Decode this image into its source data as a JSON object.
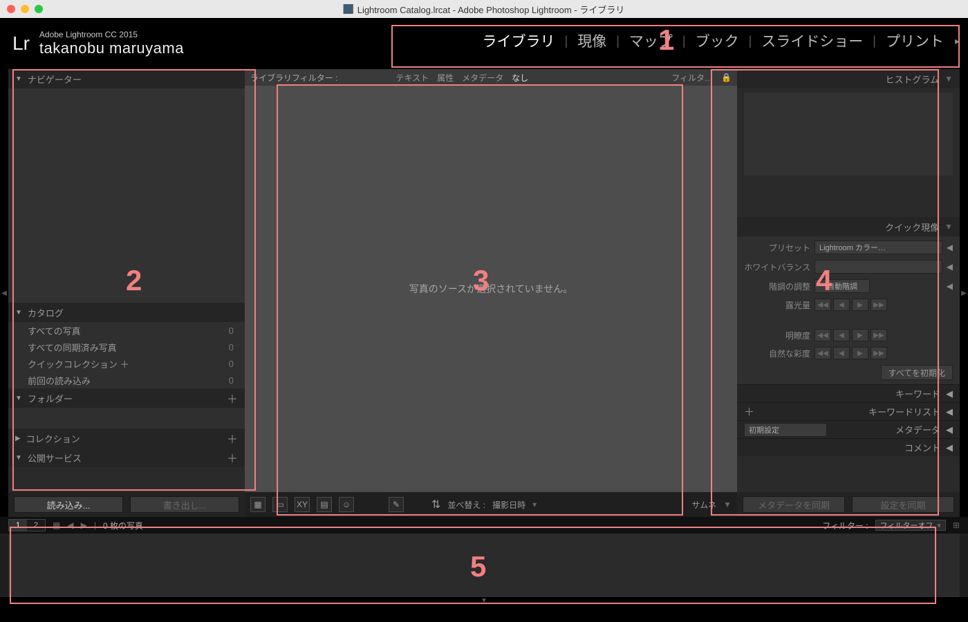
{
  "window": {
    "title": "Lightroom Catalog.lrcat - Adobe Photoshop Lightroom - ライブラリ"
  },
  "identity": {
    "product": "Adobe Lightroom CC 2015",
    "user": "takanobu maruyama",
    "logo": "Lr"
  },
  "modules": {
    "items": [
      "ライブラリ",
      "現像",
      "マップ",
      "ブック",
      "スライドショー",
      "プリント"
    ],
    "active_index": 0
  },
  "annotations": {
    "n1": "1",
    "n2": "2",
    "n3": "3",
    "n4": "4",
    "n5": "5"
  },
  "left": {
    "navigator": {
      "title": "ナビゲーター"
    },
    "catalog": {
      "title": "カタログ",
      "items": [
        {
          "label": "すべての写真",
          "count": "0"
        },
        {
          "label": "すべての同期済み写真",
          "count": "0"
        },
        {
          "label": "クイックコレクション ＋",
          "count": "0"
        },
        {
          "label": "前回の読み込み",
          "count": "0"
        }
      ]
    },
    "folders": {
      "title": "フォルダー"
    },
    "collections": {
      "title": "コレクション"
    },
    "publish": {
      "title": "公開サービス"
    },
    "footer": {
      "import": "読み込み...",
      "export": "書き出し..."
    }
  },
  "center": {
    "filterbar": {
      "label": "ライブラリフィルター :",
      "tabs": [
        "テキスト",
        "属性",
        "メタデータ",
        "なし"
      ],
      "active_index": 3,
      "menu": "フィルタ…"
    },
    "empty_msg": "写真のソースが選択されていません。",
    "toolbar": {
      "sort_label": "並べ替え :",
      "sort_value": "撮影日時",
      "thumb": "サムネ"
    }
  },
  "right": {
    "histogram": {
      "title": "ヒストグラム"
    },
    "quickdev": {
      "title": "クイック現像",
      "preset_label": "プリセット",
      "preset_value": "Lightroom カラー…",
      "wb_label": "ホワイトバランス",
      "wb_value": "",
      "tone_label": "階調の調整",
      "tone_btn": "自動階調",
      "exposure_label": "露光量",
      "clarity_label": "明瞭度",
      "vibrance_label": "自然な彩度",
      "reset": "すべてを初期化"
    },
    "sections": {
      "keyword": "キーワード",
      "keyword_list": "キーワードリスト",
      "metadata_preset": "初期設定",
      "metadata": "メタデータ",
      "comment": "コメント"
    },
    "footer": {
      "sync_meta": "メタデータを同期",
      "sync_settings": "設定を同期"
    }
  },
  "filmstrip": {
    "view1": "1",
    "view2": "2",
    "count_label": "0 枚の写真",
    "filter_label": "フィルター :",
    "filter_value": "フィルターオフ"
  }
}
